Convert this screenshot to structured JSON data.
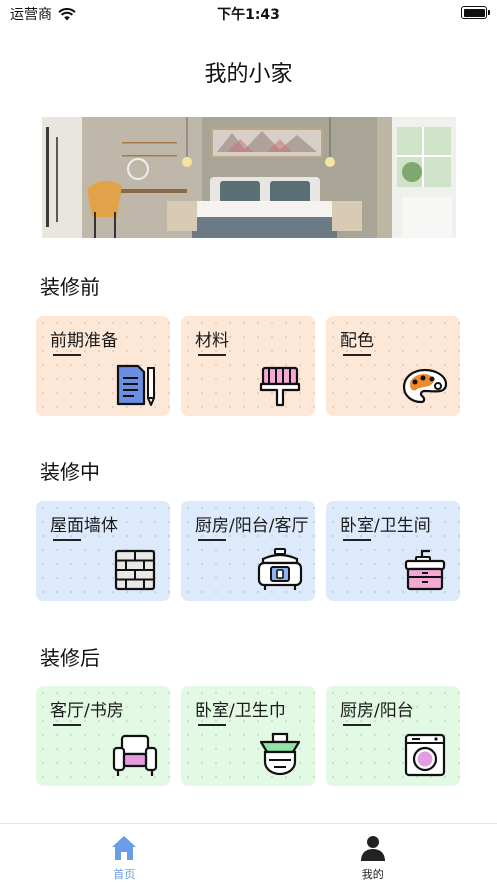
{
  "status_bar": {
    "carrier": "运营商",
    "time": "下午1:43",
    "battery_level": 1.0
  },
  "nav": {
    "title": "我的小家"
  },
  "sections": [
    {
      "title": "装修前",
      "cards": [
        {
          "label": "前期准备",
          "icon": "document-pen-icon"
        },
        {
          "label": "材料",
          "icon": "paint-brush-icon"
        },
        {
          "label": "配色",
          "icon": "palette-icon"
        }
      ]
    },
    {
      "title": "装修中",
      "cards": [
        {
          "label": "屋面墙体",
          "icon": "brick-wall-icon"
        },
        {
          "label": "厨房/阳台/客厅",
          "icon": "rice-cooker-icon"
        },
        {
          "label": "卧室/卫生间",
          "icon": "sink-cabinet-icon"
        }
      ]
    },
    {
      "title": "装修后",
      "cards": [
        {
          "label": "客厅/书房",
          "icon": "armchair-icon"
        },
        {
          "label": "卧室/卫生巾",
          "icon": "range-hood-icon"
        },
        {
          "label": "厨房/阳台",
          "icon": "washing-machine-icon"
        }
      ]
    }
  ],
  "tabs": [
    {
      "label": "首页",
      "icon": "home-icon",
      "active": true
    },
    {
      "label": "我的",
      "icon": "user-icon",
      "active": false
    }
  ],
  "colors": {
    "accent": "#6a9de8",
    "peach": "#fde8d8",
    "blue": "#dceafc",
    "green": "#e2f9e4",
    "inactive": "#222222"
  }
}
